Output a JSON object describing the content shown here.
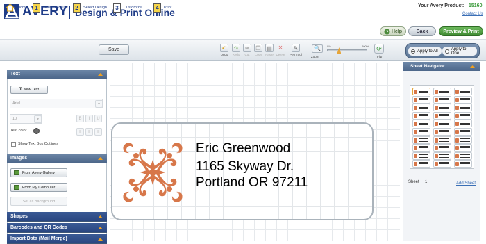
{
  "header": {
    "logo": "AVERY",
    "app_title": "Design & Print Online",
    "product_label": "Your Avery Product:",
    "product_number": "15160",
    "contact_link": "Contact Us"
  },
  "steps": [
    {
      "num": "",
      "label": "Home"
    },
    {
      "num": "1",
      "label": "Select Product"
    },
    {
      "num": "2",
      "label": "Select Design"
    },
    {
      "num": "3",
      "label": "Customize"
    },
    {
      "num": "4",
      "label": "Print"
    }
  ],
  "nav_buttons": {
    "help": "Help",
    "back": "Back",
    "preview": "Preview & Print"
  },
  "toolbar": {
    "save": "Save",
    "tools": [
      {
        "label": "Undo",
        "icon": "undo-icon",
        "enabled": true
      },
      {
        "label": "Redo",
        "icon": "redo-icon",
        "enabled": false
      },
      {
        "label": "Cut",
        "icon": "cut-icon",
        "enabled": false
      },
      {
        "label": "Copy",
        "icon": "copy-icon",
        "enabled": false
      },
      {
        "label": "Paste",
        "icon": "paste-icon",
        "enabled": false
      },
      {
        "label": "Delete",
        "icon": "delete-icon",
        "enabled": false
      },
      {
        "label": "Pen Tool",
        "icon": "pen-tool-icon",
        "enabled": true
      }
    ],
    "zoom": {
      "label": "Zoom",
      "min_label": "0%",
      "max_label": "400%",
      "value_fraction": 0.3
    },
    "flip": "Flip"
  },
  "apply": {
    "all": "Apply to All",
    "one": "Apply to One",
    "selected": "all"
  },
  "left_panel": {
    "text_section": {
      "title": "Text",
      "new_text": "New Text",
      "font": "Arial",
      "size": "10",
      "text_color_label": "Text color",
      "outline_label": "Show Text Box Outlines"
    },
    "images_section": {
      "title": "Images",
      "gallery": "From Avery Gallery",
      "computer": "From My Computer",
      "set_background": "Set as Background"
    },
    "collapsed_sections": [
      "Shapes",
      "Barcodes and QR Codes",
      "Import Data (Mail Merge)"
    ]
  },
  "label": {
    "lines": [
      "Eric Greenwood",
      "1165 Skyway Dr.",
      "Portland OR 97211"
    ],
    "ornament_color": "#d7774a"
  },
  "navigator": {
    "title": "Sheet Navigator",
    "sheet_label": "Sheet",
    "sheet_number": "1",
    "add_sheet": "Add Sheet"
  },
  "colors": {
    "brand": "#1f3c88",
    "panel_header": "#5b7597",
    "accent_orange": "#f0a020",
    "preview_green": "#4a9a3c"
  }
}
